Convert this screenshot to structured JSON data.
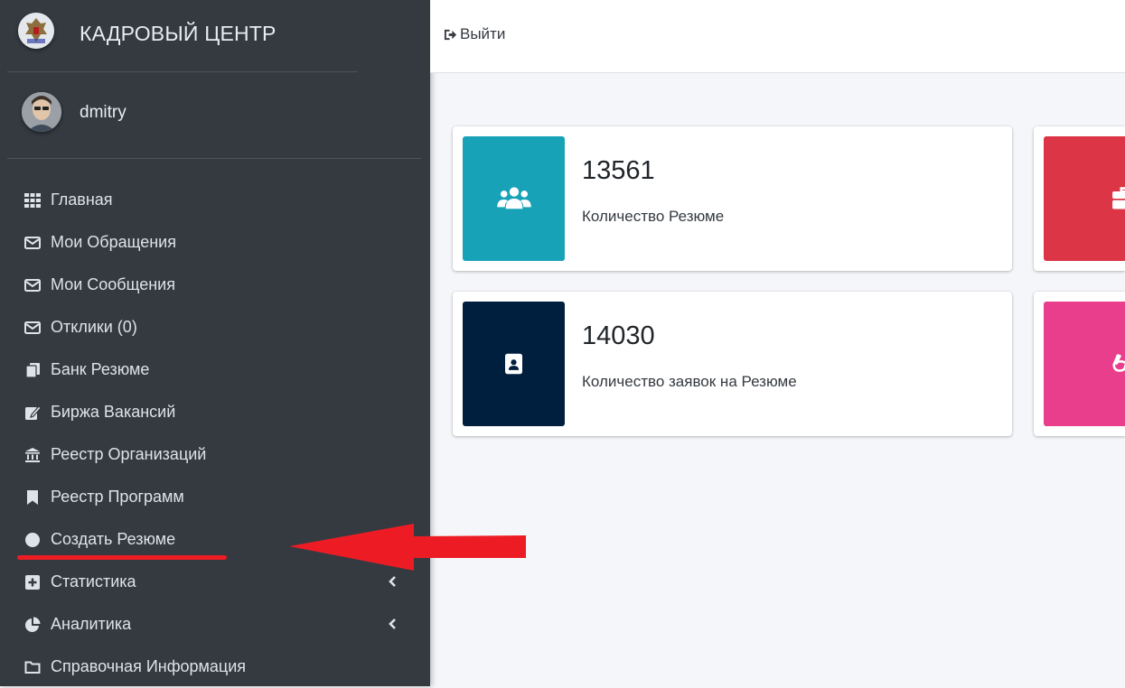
{
  "brand": {
    "title": "КАДРОВЫЙ ЦЕНТР"
  },
  "user": {
    "name": "dmitry"
  },
  "header": {
    "logout_label": "Выйти"
  },
  "nav": {
    "items": [
      {
        "label": "Главная",
        "icon": "grid-icon"
      },
      {
        "label": "Мои Обращения",
        "icon": "envelope-icon"
      },
      {
        "label": "Мои Сообщения",
        "icon": "envelope-icon"
      },
      {
        "label": "Отклики (0)",
        "icon": "envelope-icon"
      },
      {
        "label": "Банк Резюме",
        "icon": "copy-icon"
      },
      {
        "label": "Биржа Вакансий",
        "icon": "edit-icon"
      },
      {
        "label": "Реестр Организаций",
        "icon": "bank-icon"
      },
      {
        "label": "Реестр Программ",
        "icon": "bookmark-icon"
      },
      {
        "label": "Создать Резюме",
        "icon": "circle-icon"
      },
      {
        "label": "Статистика",
        "icon": "plus-square-icon"
      },
      {
        "label": "Аналитика",
        "icon": "pie-chart-icon"
      },
      {
        "label": "Справочная Информация",
        "icon": "folder-icon"
      }
    ]
  },
  "stats": {
    "resumes": {
      "value": "13561",
      "label": "Количество Резюме",
      "color": "#17a2b8",
      "icon": "users-icon"
    },
    "requests": {
      "value": "14030",
      "label": "Количество заявок на Резюме",
      "color": "#001f3f",
      "icon": "id-badge-icon"
    },
    "right_top": {
      "color": "#dc3545",
      "icon": "business-time-icon"
    },
    "right_bottom": {
      "color": "#e83e8c",
      "icon": "glasses-icon"
    }
  },
  "colors": {
    "sidebar": "#343a40",
    "highlight": "#ed1c24"
  }
}
